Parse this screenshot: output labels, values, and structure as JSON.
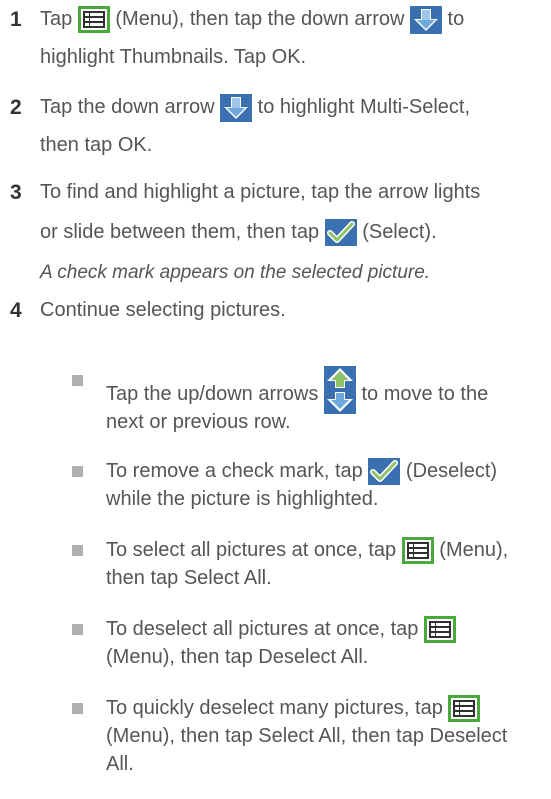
{
  "steps": [
    {
      "number": "1",
      "line1_pre": "Tap",
      "line1_mid": "(Menu), then tap the down arrow",
      "line1_post": "to",
      "line2": "highlight Thumbnails. Tap OK."
    },
    {
      "number": "2",
      "line1_pre": "Tap the down arrow",
      "line1_post": "to highlight Multi-Select,",
      "line2": "then tap OK."
    },
    {
      "number": "3",
      "line1": "To find and highlight a picture, tap the arrow lights",
      "line2_pre": "or slide between them, then tap",
      "line2_post": "(Select).",
      "note": "A check mark appears on the selected picture."
    },
    {
      "number": "4",
      "line1": "Continue selecting pictures."
    }
  ],
  "bullets": [
    {
      "line1_pre": "Tap the up/down arrows",
      "line1_post": "to move to the",
      "line2": "next or previous row."
    },
    {
      "line1_pre": "To remove a check mark, tap",
      "line1_post": "(Deselect)",
      "line2": "while the picture is highlighted."
    },
    {
      "line1_pre": "To select all pictures at once, tap",
      "line1_post": "(Menu),",
      "line2": "then tap Select All."
    },
    {
      "line1_pre": "To deselect all pictures at once, tap",
      "line2": "(Menu), then tap Deselect All."
    },
    {
      "line1_pre": "To quickly deselect many pictures, tap",
      "line2": "(Menu), then tap Select All, then tap Deselect",
      "line3": "All."
    }
  ],
  "icons": {
    "menu": "menu-icon",
    "down_arrow": "down-arrow-icon",
    "check": "check-icon",
    "up_down": "up-down-arrow-icon",
    "icon_green": "#4aa83c",
    "icon_blue": "#3a6fb0"
  }
}
